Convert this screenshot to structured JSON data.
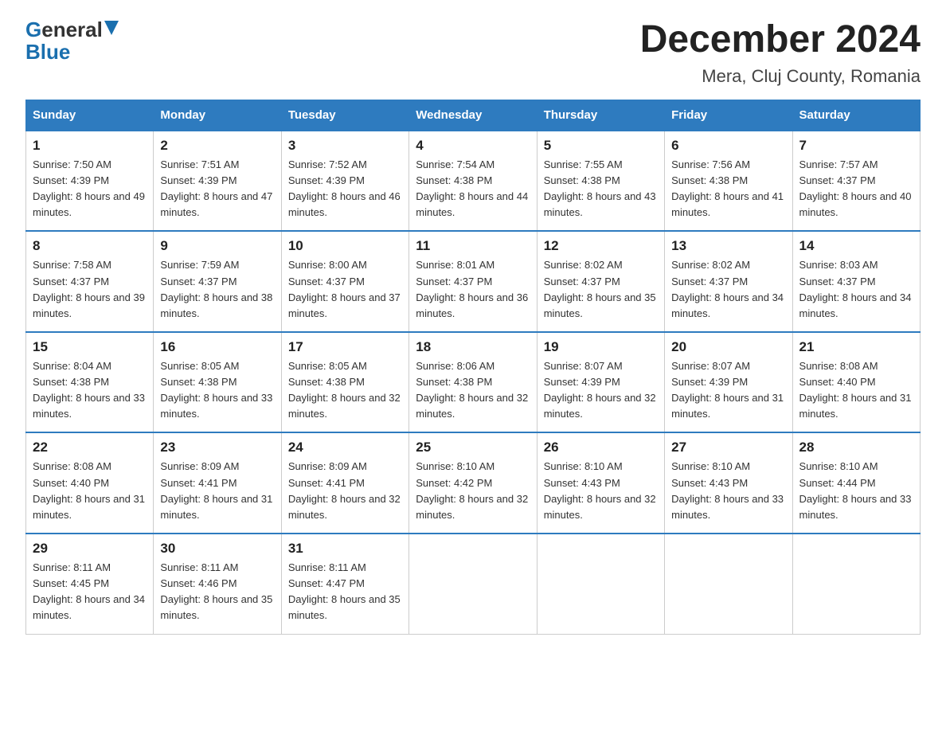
{
  "header": {
    "logo_general": "General",
    "logo_blue": "Blue",
    "month_year": "December 2024",
    "location": "Mera, Cluj County, Romania"
  },
  "columns": [
    "Sunday",
    "Monday",
    "Tuesday",
    "Wednesday",
    "Thursday",
    "Friday",
    "Saturday"
  ],
  "weeks": [
    [
      {
        "day": "1",
        "sunrise": "7:50 AM",
        "sunset": "4:39 PM",
        "daylight": "8 hours and 49 minutes."
      },
      {
        "day": "2",
        "sunrise": "7:51 AM",
        "sunset": "4:39 PM",
        "daylight": "8 hours and 47 minutes."
      },
      {
        "day": "3",
        "sunrise": "7:52 AM",
        "sunset": "4:39 PM",
        "daylight": "8 hours and 46 minutes."
      },
      {
        "day": "4",
        "sunrise": "7:54 AM",
        "sunset": "4:38 PM",
        "daylight": "8 hours and 44 minutes."
      },
      {
        "day": "5",
        "sunrise": "7:55 AM",
        "sunset": "4:38 PM",
        "daylight": "8 hours and 43 minutes."
      },
      {
        "day": "6",
        "sunrise": "7:56 AM",
        "sunset": "4:38 PM",
        "daylight": "8 hours and 41 minutes."
      },
      {
        "day": "7",
        "sunrise": "7:57 AM",
        "sunset": "4:37 PM",
        "daylight": "8 hours and 40 minutes."
      }
    ],
    [
      {
        "day": "8",
        "sunrise": "7:58 AM",
        "sunset": "4:37 PM",
        "daylight": "8 hours and 39 minutes."
      },
      {
        "day": "9",
        "sunrise": "7:59 AM",
        "sunset": "4:37 PM",
        "daylight": "8 hours and 38 minutes."
      },
      {
        "day": "10",
        "sunrise": "8:00 AM",
        "sunset": "4:37 PM",
        "daylight": "8 hours and 37 minutes."
      },
      {
        "day": "11",
        "sunrise": "8:01 AM",
        "sunset": "4:37 PM",
        "daylight": "8 hours and 36 minutes."
      },
      {
        "day": "12",
        "sunrise": "8:02 AM",
        "sunset": "4:37 PM",
        "daylight": "8 hours and 35 minutes."
      },
      {
        "day": "13",
        "sunrise": "8:02 AM",
        "sunset": "4:37 PM",
        "daylight": "8 hours and 34 minutes."
      },
      {
        "day": "14",
        "sunrise": "8:03 AM",
        "sunset": "4:37 PM",
        "daylight": "8 hours and 34 minutes."
      }
    ],
    [
      {
        "day": "15",
        "sunrise": "8:04 AM",
        "sunset": "4:38 PM",
        "daylight": "8 hours and 33 minutes."
      },
      {
        "day": "16",
        "sunrise": "8:05 AM",
        "sunset": "4:38 PM",
        "daylight": "8 hours and 33 minutes."
      },
      {
        "day": "17",
        "sunrise": "8:05 AM",
        "sunset": "4:38 PM",
        "daylight": "8 hours and 32 minutes."
      },
      {
        "day": "18",
        "sunrise": "8:06 AM",
        "sunset": "4:38 PM",
        "daylight": "8 hours and 32 minutes."
      },
      {
        "day": "19",
        "sunrise": "8:07 AM",
        "sunset": "4:39 PM",
        "daylight": "8 hours and 32 minutes."
      },
      {
        "day": "20",
        "sunrise": "8:07 AM",
        "sunset": "4:39 PM",
        "daylight": "8 hours and 31 minutes."
      },
      {
        "day": "21",
        "sunrise": "8:08 AM",
        "sunset": "4:40 PM",
        "daylight": "8 hours and 31 minutes."
      }
    ],
    [
      {
        "day": "22",
        "sunrise": "8:08 AM",
        "sunset": "4:40 PM",
        "daylight": "8 hours and 31 minutes."
      },
      {
        "day": "23",
        "sunrise": "8:09 AM",
        "sunset": "4:41 PM",
        "daylight": "8 hours and 31 minutes."
      },
      {
        "day": "24",
        "sunrise": "8:09 AM",
        "sunset": "4:41 PM",
        "daylight": "8 hours and 32 minutes."
      },
      {
        "day": "25",
        "sunrise": "8:10 AM",
        "sunset": "4:42 PM",
        "daylight": "8 hours and 32 minutes."
      },
      {
        "day": "26",
        "sunrise": "8:10 AM",
        "sunset": "4:43 PM",
        "daylight": "8 hours and 32 minutes."
      },
      {
        "day": "27",
        "sunrise": "8:10 AM",
        "sunset": "4:43 PM",
        "daylight": "8 hours and 33 minutes."
      },
      {
        "day": "28",
        "sunrise": "8:10 AM",
        "sunset": "4:44 PM",
        "daylight": "8 hours and 33 minutes."
      }
    ],
    [
      {
        "day": "29",
        "sunrise": "8:11 AM",
        "sunset": "4:45 PM",
        "daylight": "8 hours and 34 minutes."
      },
      {
        "day": "30",
        "sunrise": "8:11 AM",
        "sunset": "4:46 PM",
        "daylight": "8 hours and 35 minutes."
      },
      {
        "day": "31",
        "sunrise": "8:11 AM",
        "sunset": "4:47 PM",
        "daylight": "8 hours and 35 minutes."
      },
      null,
      null,
      null,
      null
    ]
  ]
}
